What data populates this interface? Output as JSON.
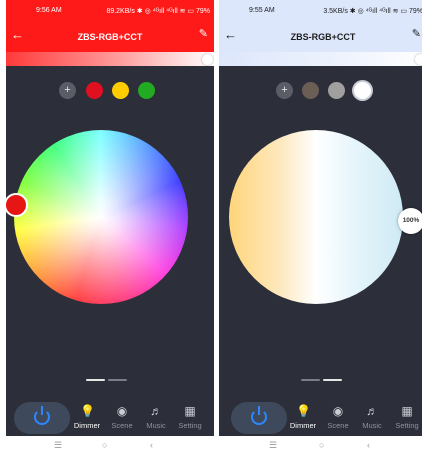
{
  "screens": [
    {
      "status": {
        "time": "9:56 AM",
        "net": "89.2KB/s ✱ ◎ ⁴ᴳıll ⁴ᴳıll ≋ ▭ 79%"
      },
      "title": "ZBS-RGB+CCT",
      "mode": "RGB",
      "swatches": [
        "#e01020",
        "#ffcc00",
        "#22aa22"
      ],
      "selected_color": "#e81515",
      "active_page": 1
    },
    {
      "status": {
        "time": "9:55 AM",
        "net": "3.5KB/s ✱ ◎ ⁴ᴳıll ⁴ᴳıll ≋ ▭ 79%"
      },
      "title": "ZBS-RGB+CCT",
      "mode": "CCT",
      "swatches": [
        "#6b5e55",
        "#a29f9f",
        "#ffffff"
      ],
      "brightness_label": "100%",
      "active_page": 2
    }
  ],
  "nav": {
    "dimmer": "Dimmer",
    "scene": "Scene",
    "music": "Music",
    "setting": "Setting"
  },
  "colors": {
    "accent_red": "#ff1a1a",
    "accent_blue": "#2e86ff",
    "background": "#2c2f3a"
  }
}
